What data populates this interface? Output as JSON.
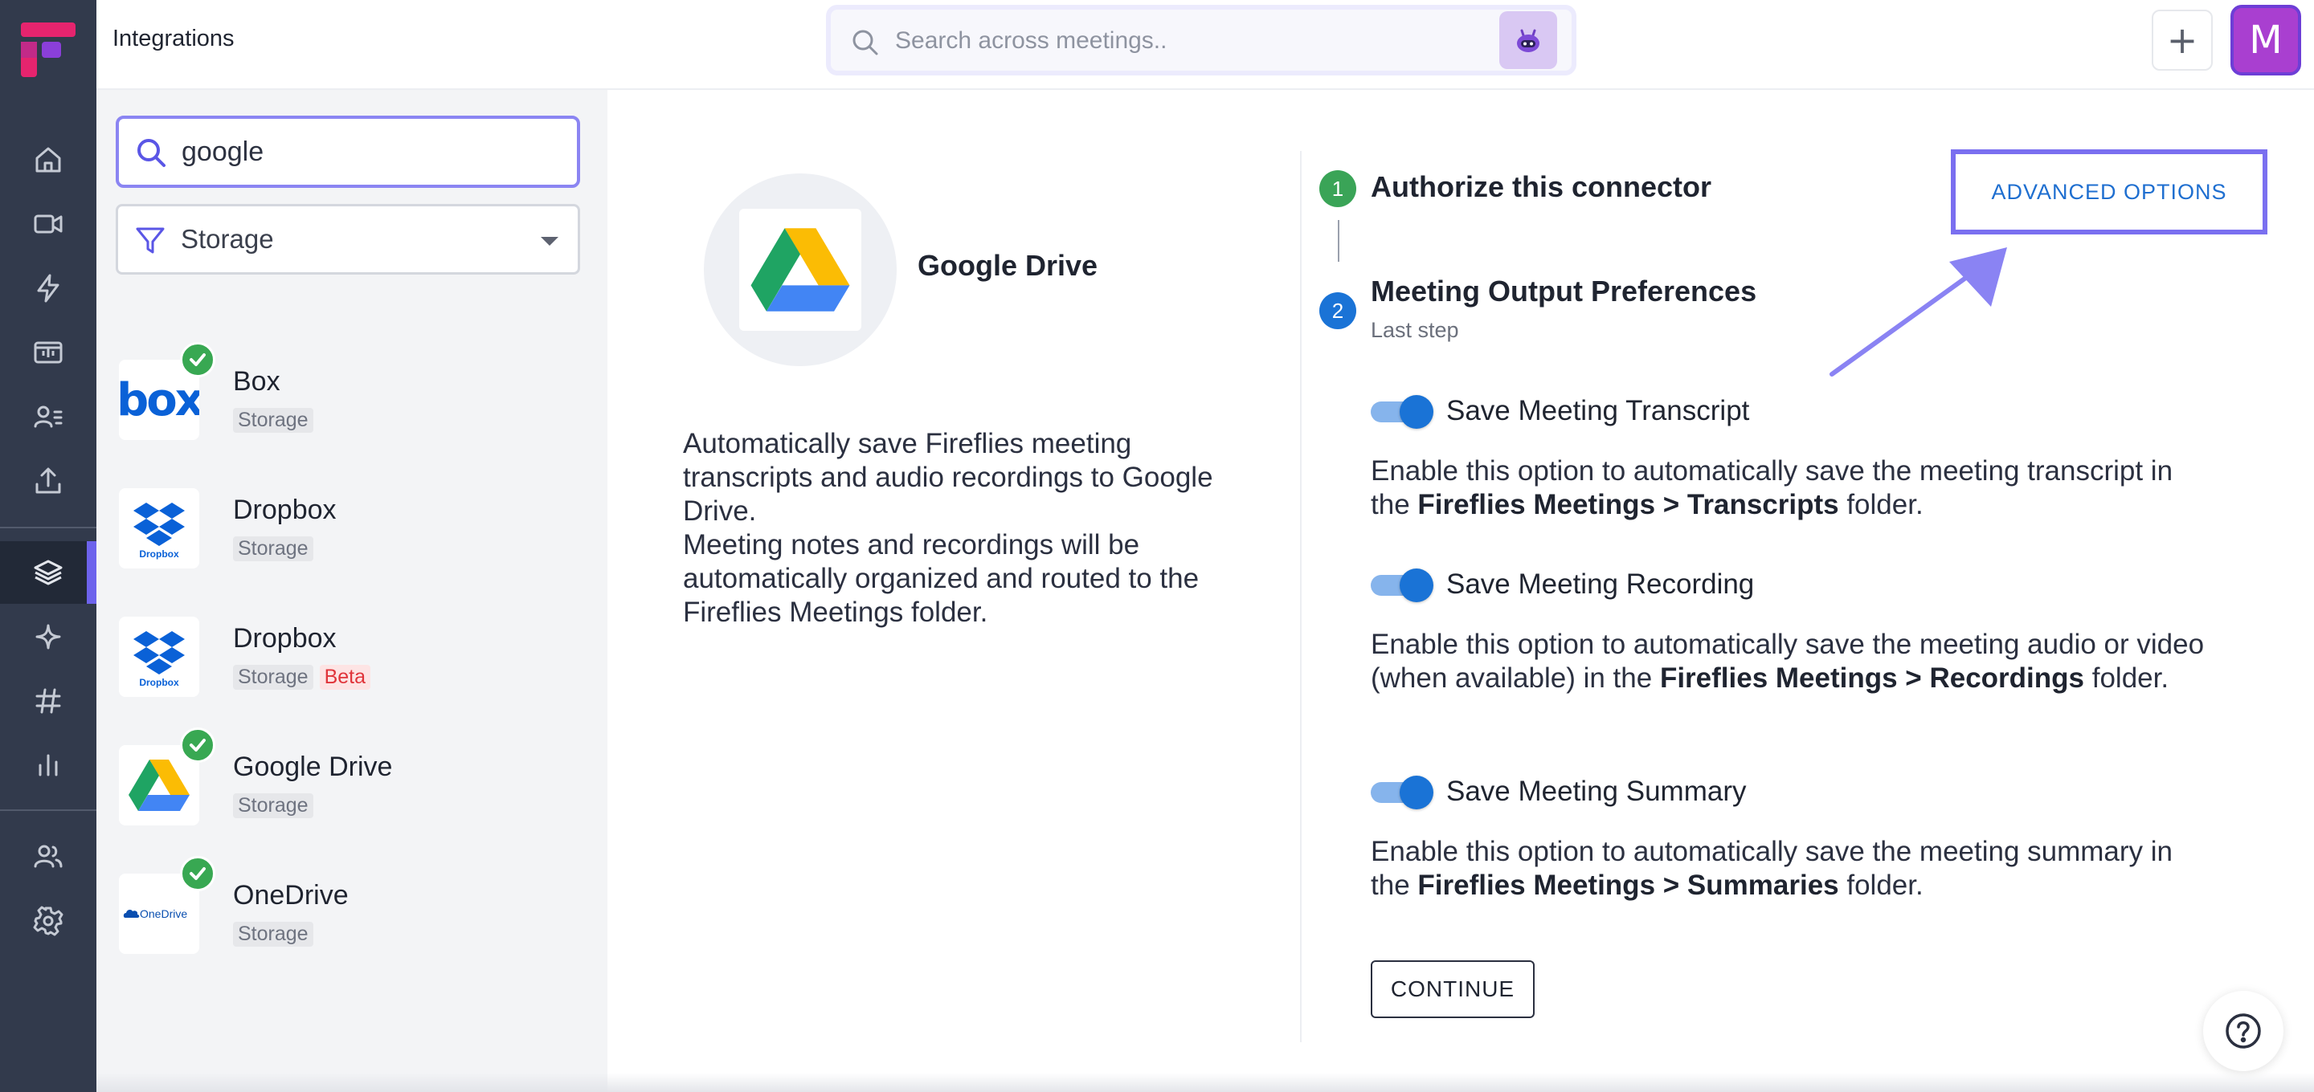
{
  "header": {
    "title": "Integrations",
    "search_placeholder": "Search across meetings..",
    "plus_label": "+",
    "avatar_initial": "M"
  },
  "filters": {
    "search_value": "google",
    "category_selected": "Storage"
  },
  "integrations": [
    {
      "name": "Box",
      "tags": [
        "Storage"
      ],
      "installed": true,
      "icon": "box-logo"
    },
    {
      "name": "Dropbox",
      "tags": [
        "Storage"
      ],
      "installed": false,
      "icon": "dropbox-logo"
    },
    {
      "name": "Dropbox",
      "tags": [
        "Storage",
        "Beta"
      ],
      "installed": false,
      "icon": "dropbox-logo"
    },
    {
      "name": "Google Drive",
      "tags": [
        "Storage"
      ],
      "installed": true,
      "icon": "google-drive-logo"
    },
    {
      "name": "OneDrive",
      "tags": [
        "Storage"
      ],
      "installed": true,
      "icon": "onedrive-logo"
    }
  ],
  "logo_text": {
    "box": "box",
    "dropbox": "Dropbox",
    "onedrive": "OneDrive"
  },
  "detail": {
    "app_name": "Google Drive",
    "description_1": "Automatically save Fireflies meeting transcripts and audio recordings to Google Drive.",
    "description_2": "Meeting notes and recordings will be automatically organized and routed to the Fireflies Meetings folder.",
    "advanced_options_label": "ADVANCED OPTIONS",
    "steps": [
      {
        "number": "1",
        "title": "Authorize this connector",
        "status": "done"
      },
      {
        "number": "2",
        "title": "Meeting Output Preferences",
        "subtitle": "Last step",
        "status": "current"
      }
    ],
    "options": [
      {
        "label": "Save Meeting Transcript",
        "enabled": true,
        "desc_pre": "Enable this option to automatically save the meeting transcript in the ",
        "desc_bold": "Fireflies Meetings > Transcripts",
        "desc_post": " folder."
      },
      {
        "label": "Save Meeting Recording",
        "enabled": true,
        "desc_pre": "Enable this option to automatically save the meeting audio or video (when available) in the ",
        "desc_bold": "Fireflies Meetings > Recordings",
        "desc_post": " folder."
      },
      {
        "label": "Save Meeting Summary",
        "enabled": true,
        "desc_pre": "Enable this option to automatically save the meeting summary in the ",
        "desc_bold": "Fireflies Meetings > Summaries",
        "desc_post": " folder."
      }
    ],
    "continue_label": "CONTINUE"
  },
  "colors": {
    "rail": "#323a4c",
    "accent": "#6d63ec",
    "primary_blue": "#1a73d6",
    "success_green": "#38a852",
    "beta_red": "#e0343a"
  }
}
